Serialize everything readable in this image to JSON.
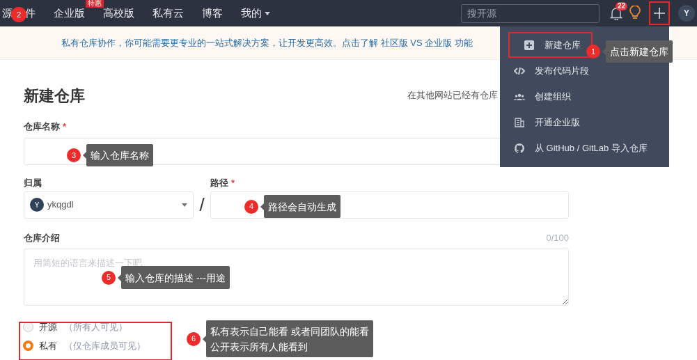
{
  "navbar": {
    "items": [
      {
        "kind": "split",
        "parts": [
          "源",
          "件"
        ],
        "marker": "2"
      },
      {
        "kind": "plain",
        "label": "企业版",
        "badge": "特惠"
      },
      {
        "kind": "plain",
        "label": "高校版"
      },
      {
        "kind": "plain",
        "label": "私有云"
      },
      {
        "kind": "plain",
        "label": "博客"
      },
      {
        "kind": "menu",
        "label": "我的"
      }
    ],
    "search": {
      "placeholder": "搜开源"
    },
    "notifications": "22",
    "avatar": "Y"
  },
  "banner": "私有仓库协作，你可能需要更专业的一站式解决方案，让开发更高效。点击了解 社区版 VS 企业版 功能",
  "page": {
    "title": "新建仓库",
    "import_hint": "在其他网站已经有仓库",
    "name_label": "仓库名称",
    "owner_label": "归属",
    "owner": {
      "avatar": "Y",
      "value": "ykqgdl"
    },
    "separator": "/",
    "path_label": "路径",
    "required_mark": "*",
    "description_label": "仓库介绍",
    "counter": "0/100",
    "description_placeholder": "用简短的语言来描述一下吧",
    "visibility": [
      {
        "label": "开源",
        "hint": "（所有人可见）",
        "selected": false
      },
      {
        "label": "私有",
        "hint": "（仅仓库成员可见）",
        "selected": true
      }
    ]
  },
  "create_menu": [
    {
      "kind": "plus",
      "label": "新建仓库",
      "selected": true
    },
    {
      "kind": "code",
      "label": "发布代码片段",
      "selected": false
    },
    {
      "kind": "team",
      "label": "创建组织",
      "selected": false
    },
    {
      "kind": "building",
      "label": "开通企业版",
      "selected": false
    },
    {
      "kind": "github",
      "label": "从 GitHub / GitLab 导入仓库",
      "selected": false
    }
  ],
  "annotations": [
    {
      "number": "1",
      "text": [
        "点击新建仓库"
      ]
    },
    {
      "number": "3",
      "text": [
        "输入仓库名称"
      ]
    },
    {
      "number": "4",
      "text": [
        "路径会自动生成"
      ]
    },
    {
      "number": "5",
      "text": [
        "输入仓库的描述 ---用途"
      ]
    },
    {
      "number": "6",
      "text": [
        "私有表示自己能看 或者同团队的能看",
        "公开表示所有人能看到"
      ]
    }
  ]
}
